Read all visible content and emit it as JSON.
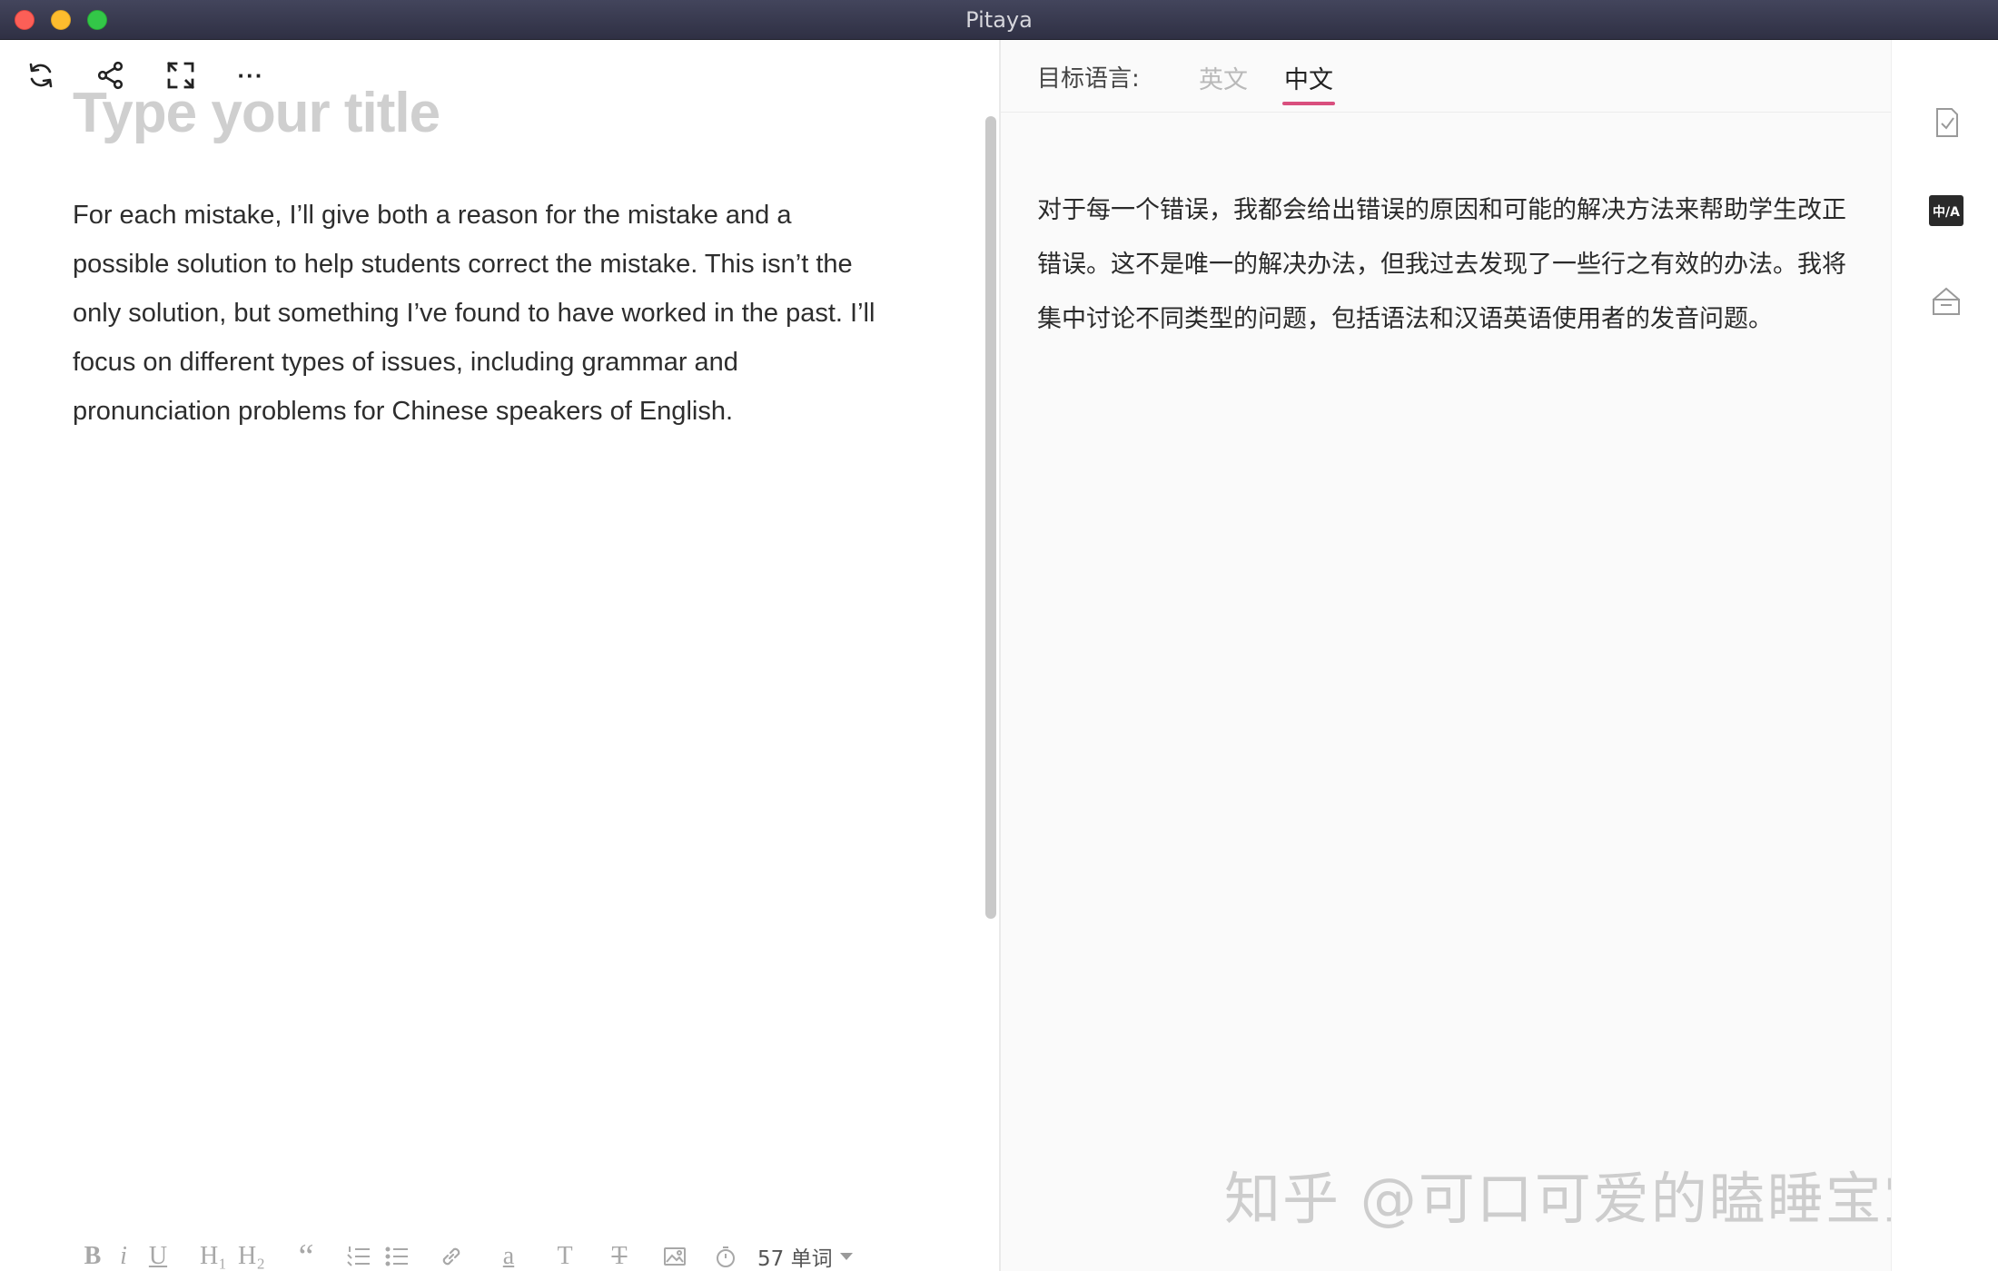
{
  "window": {
    "title": "Pitaya"
  },
  "editor": {
    "title_placeholder": "Type your title",
    "body": "For each mistake, I’ll give both a reason for the mistake and a possible solution to help students correct the mistake. This isn’t the only solution, but something I’ve found to have worked in the past. I’ll focus on different types of issues, including grammar and pronunciation problems for Chinese speakers of English.",
    "toolbar": {
      "refresh_icon": "refresh-icon",
      "share_icon": "share-icon",
      "fullscreen_icon": "fullscreen-icon",
      "more_label": "···"
    },
    "format_bar": {
      "bold": "B",
      "italic": "i",
      "underline": "U",
      "h1": "H₁",
      "h2": "H₂",
      "quote": "“",
      "highlight": "a",
      "text": "T",
      "clear_format": "T",
      "word_count": "57 单词"
    }
  },
  "translate": {
    "target_label": "目标语言:",
    "tabs": [
      {
        "label": "英文",
        "active": false
      },
      {
        "label": "中文",
        "active": true
      }
    ],
    "text": "对于每一个错误，我都会给出错误的原因和可能的解决方法来帮助学生改正错误。这不是唯一的解决办法，但我过去发现了一些行之有效的办法。我将集中讨论不同类型的问题，包括语法和汉语英语使用者的发音问题。",
    "watermark": "知乎 @可口可爱的瞌睡宝宝"
  },
  "sidebar": {
    "items": [
      {
        "icon": "check-document-icon"
      },
      {
        "icon": "translate-icon",
        "label": "中/A"
      },
      {
        "icon": "inbox-icon"
      }
    ]
  },
  "colors": {
    "accent": "#d94f7e",
    "titlebar": "#3a3b50"
  }
}
